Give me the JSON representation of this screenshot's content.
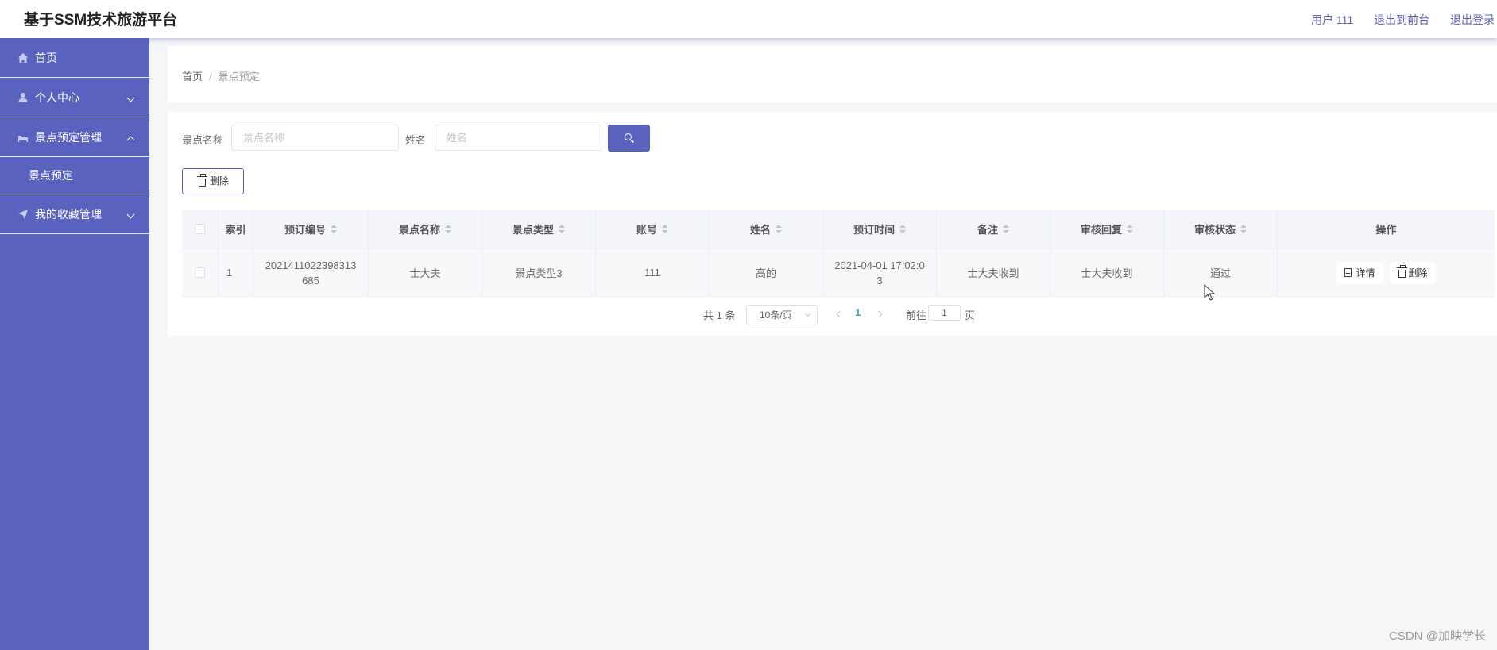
{
  "app": {
    "title": "基于SSM技术旅游平台",
    "user_label": "用户 111",
    "to_front_label": "退出到前台",
    "logout_label": "退出登录"
  },
  "sidebar": {
    "items": [
      {
        "label": "首页",
        "icon": "home-icon"
      },
      {
        "label": "个人中心",
        "icon": "user-icon"
      },
      {
        "label": "景点预定管理",
        "icon": "hotel-icon"
      },
      {
        "label": "景点预定"
      },
      {
        "label": "我的收藏管理",
        "icon": "send-icon"
      }
    ]
  },
  "breadcrumb": {
    "home": "首页",
    "separator": "/",
    "current": "景点预定"
  },
  "search": {
    "name_label": "景点名称",
    "name_placeholder": "景点名称",
    "name_value": "",
    "person_label": "姓名",
    "person_placeholder": "姓名",
    "person_value": ""
  },
  "toolbar": {
    "delete_label": "删除"
  },
  "table": {
    "columns": [
      "索引",
      "预订编号",
      "景点名称",
      "景点类型",
      "账号",
      "姓名",
      "预订时间",
      "备注",
      "审核回复",
      "审核状态",
      "操作"
    ],
    "rows": [
      {
        "index": "1",
        "order_no": "2021411022398313685",
        "spot_name": "士大夫",
        "spot_type": "景点类型3",
        "account": "111",
        "name": "高的",
        "time": "2021-04-01 17:02:03",
        "remark": "士大夫收到",
        "reply": "士大夫收到",
        "status": "通过",
        "detail_label": "详情",
        "delete_label": "删除"
      }
    ]
  },
  "pagination": {
    "total_text": "共 1 条",
    "page_size": "10条/页",
    "current_page": "1",
    "goto_label": "前往",
    "goto_value": "1",
    "page_unit": "页"
  },
  "watermark": "CSDN @加映学长",
  "colors": {
    "primary": "#5a62bf",
    "active_page": "#39a9a1"
  }
}
